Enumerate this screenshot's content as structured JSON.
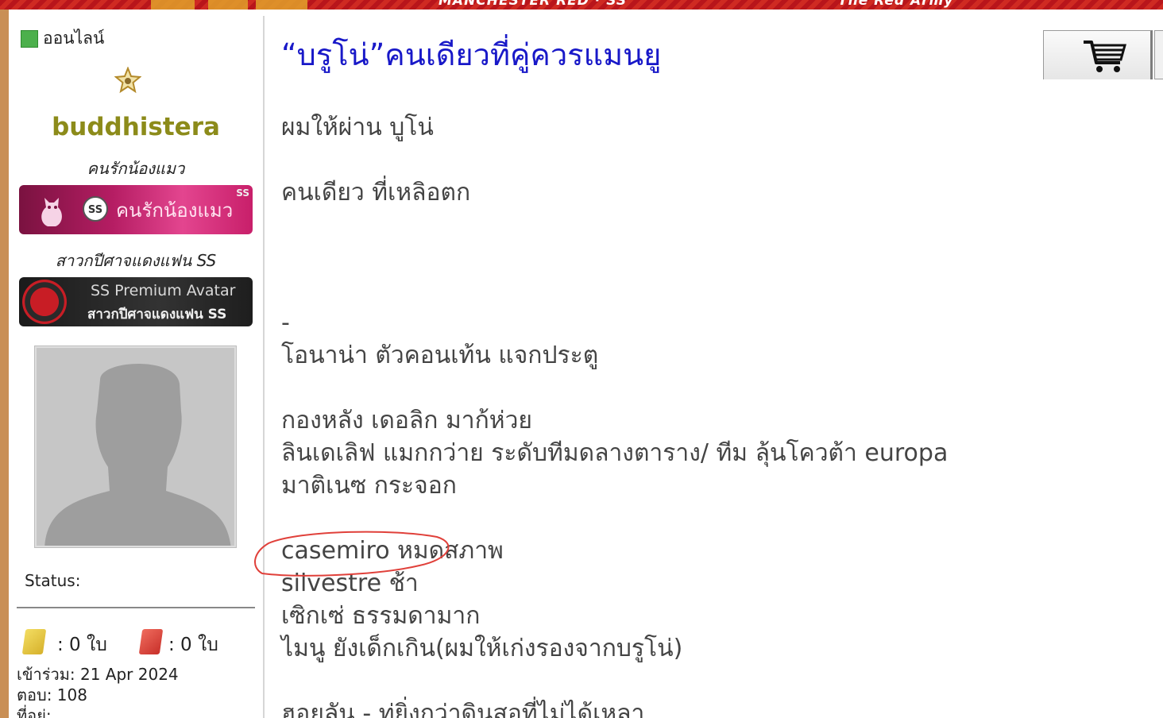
{
  "banner": {
    "center_text": "MANCHESTER RED · SS",
    "right_text": "The Red Army"
  },
  "sidebar": {
    "online_label": "ออนไลน์",
    "username": "buddhistera",
    "rank_title_1": "คนรักน้องแมว",
    "badge_cat": {
      "ss_text": "SS",
      "label": "คนรักน้องแมว",
      "corner_mark": "SS"
    },
    "rank_title_2": "สาวกปีศาจแดงแฟน SS",
    "badge_premium": {
      "line1": "SS Premium Avatar",
      "line2": "สาวกปีศาจแดงแฟน SS"
    },
    "status_label": "Status:",
    "yellow_cards": ": 0 ใบ",
    "red_cards": ": 0 ใบ",
    "joined": "เข้าร่วม: 21 Apr 2024",
    "replies": "ตอบ: 108",
    "location": "ที่อยู่:"
  },
  "post": {
    "title": "“บรูโน่”คนเดียวที่คู่ควรแมนยู",
    "lines": [
      "ผมให้ผ่าน บูโน่",
      "",
      "คนเดียว ที่เหลิอตก",
      "",
      "",
      "",
      "-",
      "โอนาน่า ตัวคอนเท้น แจกประตู",
      "",
      "กองหลัง เดอลิก มาก้ห่วย",
      "ลินเดเลิฟ แมกกว่าย ระดับทีมดลางตาราง/ ทีม ลุ้นโควต้า europa",
      "มาติเนซ กระจอก",
      "",
      "casemiro หมดสภาพ",
      "silvestre ช้า",
      "เซิกเซ่ ธรรมดามาก",
      "ไมนู ยังเด็กเกิน(ผมให้เก่งรองจากบรูโน่)",
      "",
      "ฮอยลัน - ทู่ยิ่งกว่าดินสอที่ไม่ได้เหลา"
    ]
  },
  "toolbar": {
    "cart_icon": "shopping-cart-icon"
  },
  "colors": {
    "title_blue": "#1818c8",
    "username_olive": "#8c8b1a",
    "online_green": "#4cb04c",
    "annotation_red": "#e0403a"
  }
}
